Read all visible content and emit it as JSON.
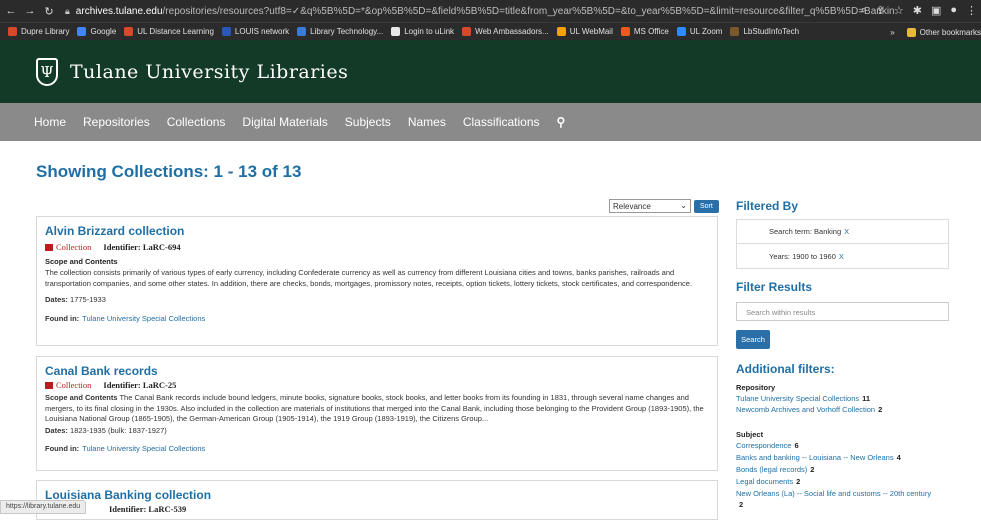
{
  "browser": {
    "url_host": "archives.tulane.edu",
    "url_path": "/repositories/resources?utf8=✓&q%5B%5D=*&op%5B%5D=&field%5B%5D=title&from_year%5B%5D=&to_year%5B%5D=&limit=resource&filter_q%5B%5D=Bankin...",
    "status_url": "https://library.tulane.edu"
  },
  "bookmarks": {
    "items": [
      {
        "label": "Dupre Library",
        "color": "#d64a2a"
      },
      {
        "label": "Google",
        "color": "#4285f4"
      },
      {
        "label": "UL Distance Learning",
        "color": "#d64a2a"
      },
      {
        "label": "LOUIS network",
        "color": "#2a58b8"
      },
      {
        "label": "Library Technology...",
        "color": "#3a7bd5"
      },
      {
        "label": "Login to uLink",
        "color": "#e8e8e8"
      },
      {
        "label": "Web Ambassadors...",
        "color": "#d64a2a"
      },
      {
        "label": "UL WebMail",
        "color": "#f2a20c"
      },
      {
        "label": "MS Office",
        "color": "#e85b22"
      },
      {
        "label": "UL Zoom",
        "color": "#2d8cff"
      },
      {
        "label": "LbStudInfoTech",
        "color": "#7a5a2a"
      }
    ],
    "more": "»",
    "other": "Other bookmarks"
  },
  "header": {
    "logo_glyph": "Ψ",
    "title": "Tulane University Libraries"
  },
  "nav": {
    "items": [
      "Home",
      "Repositories",
      "Collections",
      "Digital Materials",
      "Subjects",
      "Names",
      "Classifications"
    ],
    "search_icon": "search-icon"
  },
  "page": {
    "heading": "Showing Collections: 1 - 13 of 13",
    "sort_value": "Relevance",
    "sort_button": "Sort"
  },
  "results": [
    {
      "title": "Alvin Brizzard collection",
      "type": "Collection",
      "identifier": "Identifier: LaRC-694",
      "scope_label": "Scope and Contents",
      "abstract": "The collection consists primarily of various types of early currency, including Confederate currency as well as currency from different Louisiana cities and towns, banks parishes, railroads and transportation companies, and some other states. In addition, there are checks, bonds, mortgages, promissory notes, receipts, option tickets, lottery tickets, stock certificates, and correspondence.",
      "dates_label": "Dates:",
      "dates": "1775-1933",
      "found_label": "Found in:",
      "found_in": "Tulane University Special Collections"
    },
    {
      "title": "Canal Bank records",
      "type": "Collection",
      "identifier": "Identifier: LaRC-25",
      "scope_label": "Scope and Contents",
      "abstract": "The Canal Bank records include bound ledgers, minute books, signature books, stock books, and letter books from its founding in 1831, through several name changes and mergers, to its final closing in the 1930s. Also included in the collection are materials of institutions that merged into the Canal Bank, including those belonging to the Provident Group (1893-1905), the Louisiana National Group (1865-1905), the German-American Group (1905-1914), the 1919 Group (1893-1919), the Citizens Group...",
      "dates_label": "Dates:",
      "dates": "1823-1935 (bulk: 1837-1927)",
      "found_label": "Found in:",
      "found_in": "Tulane University Special Collections"
    },
    {
      "title": "Louisiana Banking collection",
      "identifier": "Identifier: LaRC-539"
    }
  ],
  "sidebar": {
    "filtered_by_heading": "Filtered By",
    "filters": [
      {
        "label": "Search term: Banking",
        "remove": "X"
      },
      {
        "label": "Years: 1900 to 1960",
        "remove": "X"
      }
    ],
    "filter_results_heading": "Filter Results",
    "search_placeholder": "Search within results",
    "search_button": "Search",
    "additional_heading": "Additional filters:",
    "repository_heading": "Repository",
    "repositories": [
      {
        "label": "Tulane University Special Collections",
        "count": "11"
      },
      {
        "label": "Newcomb Archives and Vorhoff Collection",
        "count": "2"
      }
    ],
    "subject_heading": "Subject",
    "subjects": [
      {
        "label": "Correspondence",
        "count": "6"
      },
      {
        "label": "Banks and banking -- Louisiana -- New Orleans",
        "count": "4"
      },
      {
        "label": "Bonds (legal records)",
        "count": "2"
      },
      {
        "label": "Legal documents",
        "count": "2"
      },
      {
        "label": "New Orleans (La) -- Social life and customs -- 20th century",
        "count": "2"
      }
    ]
  }
}
